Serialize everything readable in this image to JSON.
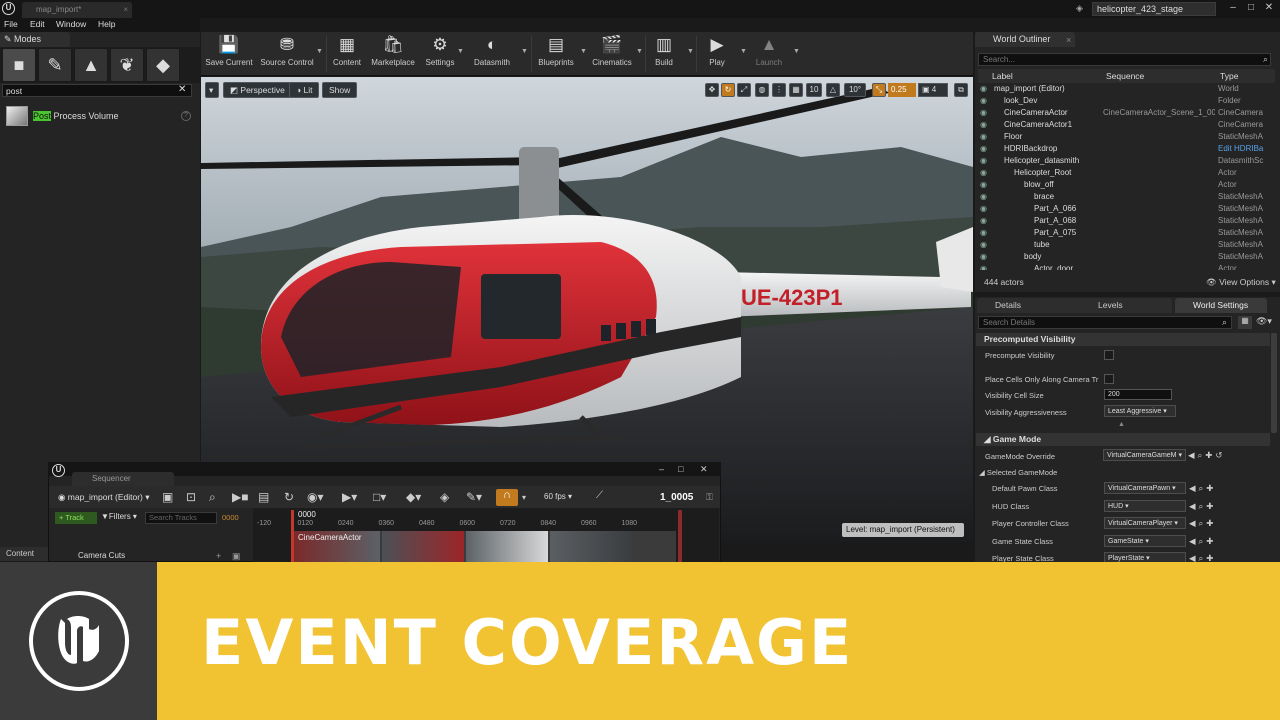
{
  "titlebar": {
    "doc_tab": "map_import*",
    "project_name": "helicopter_423_stage"
  },
  "menu": [
    "File",
    "Edit",
    "Window",
    "Help"
  ],
  "modes": {
    "tab_label": "Modes",
    "search_value": "post",
    "item_highlight": "Post",
    "item_rest": " Process Volume"
  },
  "toolbar": {
    "buttons": [
      "Save Current",
      "Source Control",
      "Content",
      "Marketplace",
      "Settings",
      "Datasmith",
      "Blueprints",
      "Cinematics",
      "Build",
      "Play",
      "Launch"
    ]
  },
  "viewport": {
    "perspective": "Perspective",
    "lit": "Lit",
    "show": "Show",
    "grid_angle": "10°",
    "snap_value": "0.25",
    "cam_speed": "4",
    "level_badge": "Level:  map_import (Persistent)",
    "tail_number": "UE-423P1"
  },
  "outliner": {
    "tab_label": "World Outliner",
    "search_placeholder": "Search...",
    "columns": [
      "Label",
      "Sequence",
      "Type"
    ],
    "rows": [
      {
        "name": "map_import (Editor)",
        "sequence": "",
        "type": "World",
        "indent": 0
      },
      {
        "name": "look_Dev",
        "sequence": "",
        "type": "Folder",
        "indent": 1
      },
      {
        "name": "CineCameraActor",
        "sequence": "CineCameraActor_Scene_1_000",
        "type": "CineCamera",
        "indent": 1
      },
      {
        "name": "CineCameraActor1",
        "sequence": "",
        "type": "CineCamera",
        "indent": 1
      },
      {
        "name": "Floor",
        "sequence": "",
        "type": "StaticMeshA",
        "indent": 1
      },
      {
        "name": "HDRIBackdrop",
        "sequence": "",
        "type": "Edit HDRIBa",
        "indent": 1,
        "link": true
      },
      {
        "name": "Helicopter_datasmith",
        "sequence": "",
        "type": "DatasmithSc",
        "indent": 1
      },
      {
        "name": "Helicopter_Root",
        "sequence": "",
        "type": "Actor",
        "indent": 2
      },
      {
        "name": "blow_off",
        "sequence": "",
        "type": "Actor",
        "indent": 3
      },
      {
        "name": "brace",
        "sequence": "",
        "type": "StaticMeshA",
        "indent": 4
      },
      {
        "name": "Part_A_066",
        "sequence": "",
        "type": "StaticMeshA",
        "indent": 4
      },
      {
        "name": "Part_A_068",
        "sequence": "",
        "type": "StaticMeshA",
        "indent": 4
      },
      {
        "name": "Part_A_075",
        "sequence": "",
        "type": "StaticMeshA",
        "indent": 4
      },
      {
        "name": "tube",
        "sequence": "",
        "type": "StaticMeshA",
        "indent": 4
      },
      {
        "name": "body",
        "sequence": "",
        "type": "StaticMeshA",
        "indent": 3
      },
      {
        "name": "Actor_door",
        "sequence": "",
        "type": "Actor",
        "indent": 4
      }
    ],
    "actor_count": "444 actors",
    "view_options": "View Options"
  },
  "details": {
    "tabs": [
      "Details",
      "Levels",
      "World Settings"
    ],
    "search_placeholder": "Search Details",
    "sec_precomputed": "Precomputed Visibility",
    "precompute_visibility": "Precompute Visibility",
    "place_cells": "Place Cells Only Along Camera Tr",
    "visibility_cell_size": "Visibility Cell Size",
    "visibility_cell_size_value": "200",
    "visibility_aggressiveness": "Visibility Aggressiveness",
    "visibility_aggressiveness_value": "Least Aggressive",
    "sec_game_mode": "Game Mode",
    "gamemode_override": "GameMode Override",
    "gamemode_override_value": "VirtualCameraGameM",
    "selected_gamemode": "Selected GameMode",
    "classes": [
      {
        "label": "Default Pawn Class",
        "value": "VirtualCameraPawn"
      },
      {
        "label": "HUD Class",
        "value": "HUD"
      },
      {
        "label": "Player Controller Class",
        "value": "VirtualCameraPlayer"
      },
      {
        "label": "Game State Class",
        "value": "GameState"
      },
      {
        "label": "Player State Class",
        "value": "PlayerState"
      }
    ]
  },
  "sequencer": {
    "tab_label": "Sequencer",
    "breadcrumb": "map_import (Editor)",
    "fps": "60 fps",
    "frame": "1_0005",
    "track_btn": "Track",
    "filters": "Filters",
    "search_placeholder": "Search Tracks",
    "time_zero": "0000",
    "playhead_label": "0000",
    "ticks": [
      "-120",
      "0120",
      "0240",
      "0360",
      "0480",
      "0600",
      "0720",
      "0840",
      "0960",
      "1080"
    ],
    "camera_cuts": "Camera Cuts",
    "shot_label": "CineCameraActor"
  },
  "content_tab": "Content",
  "banner": {
    "title": "EVENT COVERAGE"
  },
  "colors": {
    "banner_yellow": "#f1c232",
    "accent_orange": "#c17b1e",
    "track_green": "#4ac42f"
  }
}
